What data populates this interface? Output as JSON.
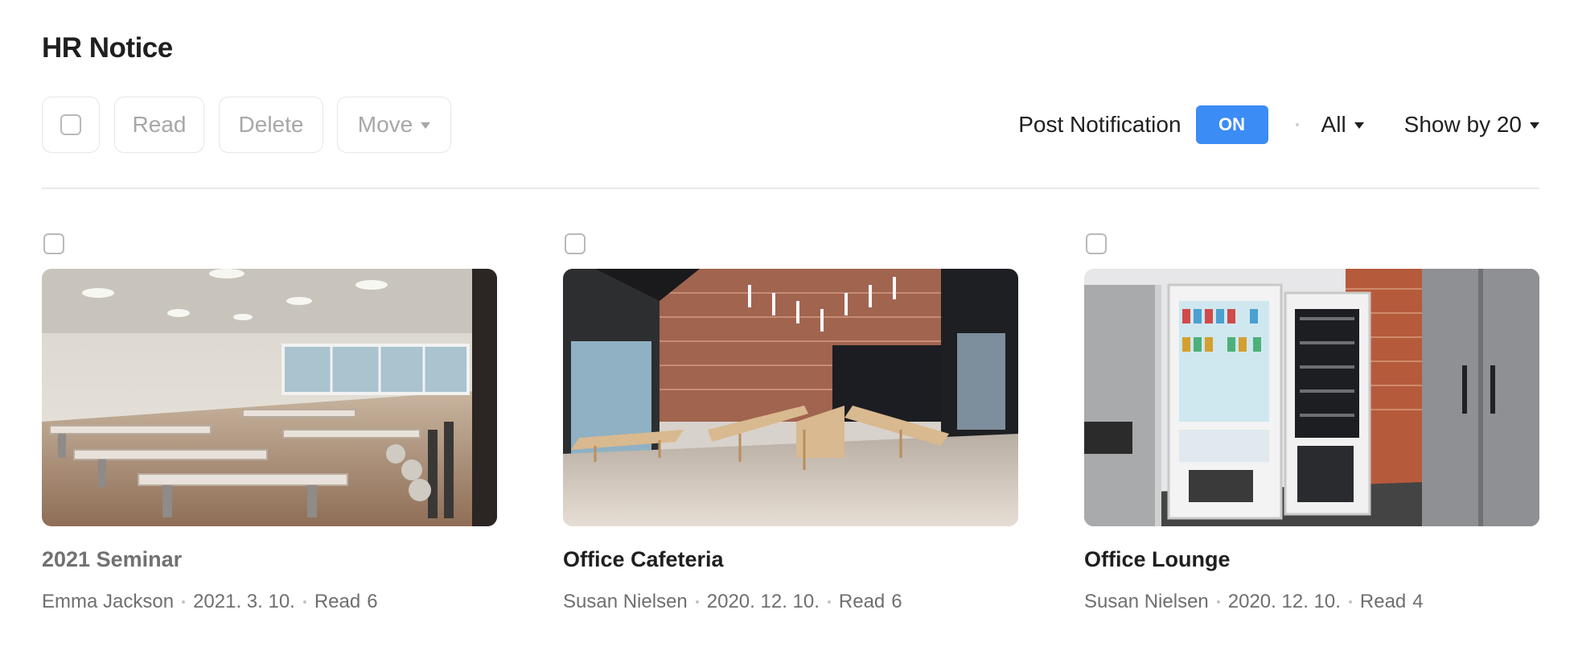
{
  "page": {
    "title": "HR Notice"
  },
  "toolbar": {
    "read_label": "Read",
    "delete_label": "Delete",
    "move_label": "Move",
    "post_notification_label": "Post Notification",
    "post_notification_toggle": "ON",
    "filter_value": "All",
    "show_by_value": "Show by 20"
  },
  "colors": {
    "accent": "#3b8cf4",
    "divider": "#e8e8e8",
    "muted_text": "#6f6f6f"
  },
  "posts": [
    {
      "title": "2021 Seminar",
      "author": "Emma Jackson",
      "date": "2021. 3. 10.",
      "read_label": "Read",
      "read_count": "6",
      "title_color": "#717171"
    },
    {
      "title": "Office Cafeteria",
      "author": "Susan Nielsen",
      "date": "2020. 12. 10.",
      "read_label": "Read",
      "read_count": "6",
      "title_color": "#1f1f1f"
    },
    {
      "title": "Office Lounge",
      "author": "Susan Nielsen",
      "date": "2020. 12. 10.",
      "read_label": "Read",
      "read_count": "4",
      "title_color": "#1f1f1f"
    }
  ]
}
